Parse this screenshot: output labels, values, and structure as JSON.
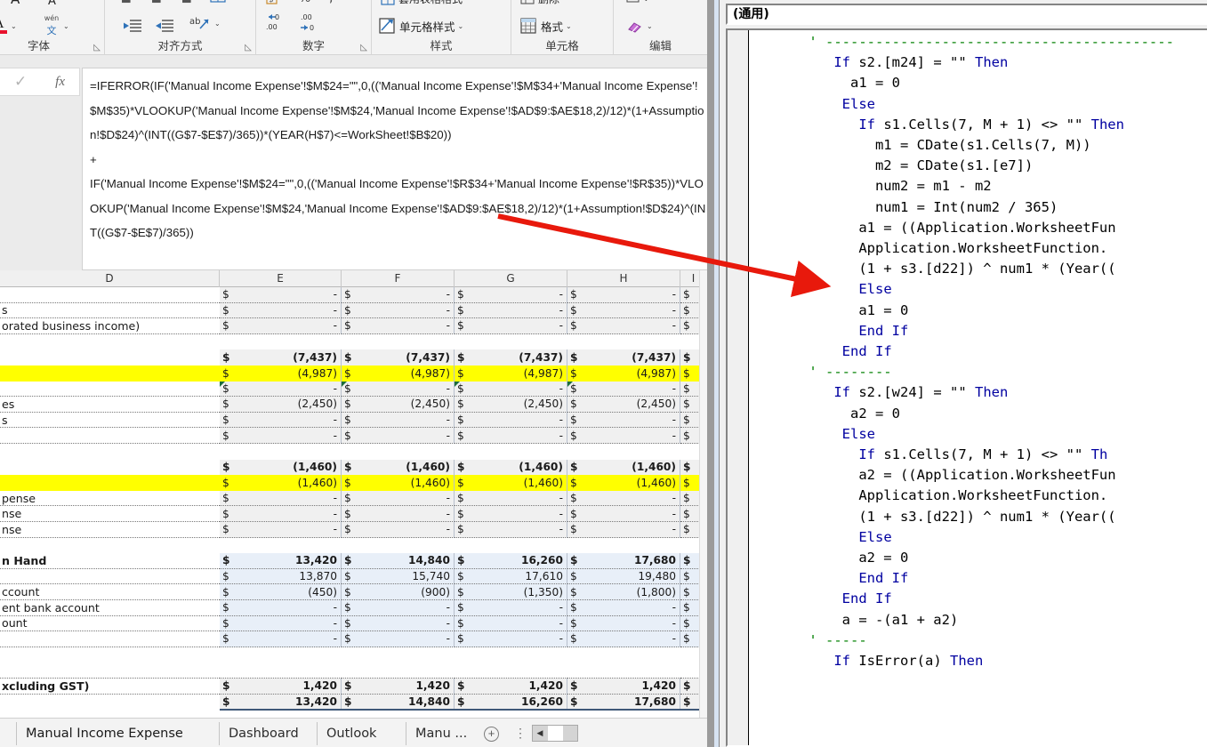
{
  "ribbon": {
    "groups": [
      {
        "title": "字体",
        "has_launcher": true
      },
      {
        "title": "对齐方式",
        "has_launcher": true
      },
      {
        "title": "数字",
        "has_launcher": true
      },
      {
        "title": "样式",
        "has_launcher": false
      },
      {
        "title": "单元格",
        "has_launcher": false
      },
      {
        "title": "编辑",
        "has_launcher": false
      }
    ],
    "buttons": {
      "font_color": "font-color-A",
      "phonetic_top": "wén",
      "phonetic_bottom": "文",
      "cell_styles": "单元格样式",
      "format": "格式",
      "clear": "clear-eraser"
    }
  },
  "formula_bar": {
    "cancel_icon": "check-icon",
    "fx_icon": "fx",
    "value": "=IFERROR(IF('Manual Income Expense'!$M$24=\"\",0,(('Manual Income Expense'!$M$34+'Manual Income Expense'!$M$35)*VLOOKUP('Manual Income Expense'!$M$24,'Manual Income Expense'!$AD$9:$AE$18,2)/12)*(1+Assumption!$D$24)^(INT((G$7-$E$7)/365))*(YEAR(H$7)<=WorkSheet!$B$20))\n+\nIF('Manual Income Expense'!$M$24=\"\",0,(('Manual Income Expense'!$R$34+'Manual Income Expense'!$R$35))*VLOOKUP('Manual Income Expense'!$M$24,'Manual Income Expense'!$AD$9:$AE$18,2)/12)*(1+Assumption!$D$24)^(INT((G$7-$E$7)/365))"
  },
  "grid": {
    "columns": [
      "D",
      "E",
      "F",
      "G",
      "H",
      "I"
    ],
    "rows": [
      {
        "label": "",
        "values": [
          "-",
          "-",
          "-",
          "-",
          "$"
        ],
        "style": "shade dot"
      },
      {
        "label": "s",
        "values": [
          "-",
          "-",
          "-",
          "-",
          "$"
        ],
        "style": "shade dot"
      },
      {
        "label": "orated business income)",
        "values": [
          "-",
          "-",
          "-",
          "-",
          "$"
        ],
        "style": "shade dot"
      },
      {
        "label": "",
        "values": [
          "",
          "",
          "",
          "",
          ""
        ],
        "style": "blank"
      },
      {
        "label": "",
        "values": [
          "(7,437)",
          "(7,437)",
          "(7,437)",
          "(7,437)",
          "$"
        ],
        "style": "shade bold"
      },
      {
        "label": "",
        "values": [
          "(4,987)",
          "(4,987)",
          "(4,987)",
          "(4,987)",
          "$"
        ],
        "style": "yellow"
      },
      {
        "label": "",
        "values": [
          "-",
          "-",
          "-",
          "-",
          "$"
        ],
        "style": "shade dot comment"
      },
      {
        "label": "es",
        "values": [
          "(2,450)",
          "(2,450)",
          "(2,450)",
          "(2,450)",
          "$"
        ],
        "style": "shade dot"
      },
      {
        "label": "s",
        "values": [
          "-",
          "-",
          "-",
          "-",
          "$"
        ],
        "style": "shade dot"
      },
      {
        "label": "",
        "values": [
          "-",
          "-",
          "-",
          "-",
          "$"
        ],
        "style": "shade dot"
      },
      {
        "label": "",
        "values": [
          "",
          "",
          "",
          "",
          ""
        ],
        "style": "blank"
      },
      {
        "label": "",
        "values": [
          "(1,460)",
          "(1,460)",
          "(1,460)",
          "(1,460)",
          "$"
        ],
        "style": "shade bold"
      },
      {
        "label": "",
        "values": [
          "(1,460)",
          "(1,460)",
          "(1,460)",
          "(1,460)",
          "$"
        ],
        "style": "yellow"
      },
      {
        "label": "pense",
        "values": [
          "-",
          "-",
          "-",
          "-",
          "$"
        ],
        "style": "shade dot"
      },
      {
        "label": "nse",
        "values": [
          "-",
          "-",
          "-",
          "-",
          "$"
        ],
        "style": "shade dot"
      },
      {
        "label": "nse",
        "values": [
          "-",
          "-",
          "-",
          "-",
          "$"
        ],
        "style": "shade dot"
      },
      {
        "label": "",
        "values": [
          "",
          "",
          "",
          "",
          ""
        ],
        "style": "blank"
      },
      {
        "label": "n Hand",
        "values": [
          "13,420",
          "14,840",
          "16,260",
          "17,680",
          "$"
        ],
        "style": "blue bold dot"
      },
      {
        "label": "",
        "values": [
          "13,870",
          "15,740",
          "17,610",
          "19,480",
          "$"
        ],
        "style": "blue dot"
      },
      {
        "label": "ccount",
        "values": [
          "(450)",
          "(900)",
          "(1,350)",
          "(1,800)",
          "$"
        ],
        "style": "blue dot"
      },
      {
        "label": "ent bank account",
        "values": [
          "-",
          "-",
          "-",
          "-",
          "$"
        ],
        "style": "blue dot"
      },
      {
        "label": "ount",
        "values": [
          "-",
          "-",
          "-",
          "-",
          "$"
        ],
        "style": "blue dot"
      },
      {
        "label": "",
        "values": [
          "-",
          "-",
          "-",
          "-",
          "$"
        ],
        "style": "blue dot"
      },
      {
        "label": "",
        "values": [
          "",
          "",
          "",
          "",
          ""
        ],
        "style": "blank"
      },
      {
        "label": "",
        "values": [
          "",
          "",
          "",
          "",
          ""
        ],
        "style": "blank dot"
      },
      {
        "label": "xcluding GST)",
        "values": [
          "1,420",
          "1,420",
          "1,420",
          "1,420",
          "$"
        ],
        "style": "shade bold dot"
      },
      {
        "label": "",
        "values": [
          "13,420",
          "14,840",
          "16,260",
          "17,680",
          "$"
        ],
        "style": "shade bold"
      }
    ],
    "currency_symbol": "$"
  },
  "sheet_tabs": {
    "items": [
      "Manual Income Expense",
      "Dashboard",
      "Outlook",
      "Manu ..."
    ],
    "add_label": "+",
    "more_label": "⋮",
    "scroll_arrow": "◀"
  },
  "vbe": {
    "combo_label": "(通用)",
    "code_lines": [
      {
        "indent": 0,
        "text": "",
        "cls": ""
      },
      {
        "indent": 7,
        "text": "' ------------------------------------------",
        "cls": "cm"
      },
      {
        "indent": 10,
        "text": "If s2.[m24] = \"\" Then",
        "cls": "kw-if"
      },
      {
        "indent": 12,
        "text": "a1 = 0",
        "cls": ""
      },
      {
        "indent": 11,
        "text": "Else",
        "cls": "kw"
      },
      {
        "indent": 13,
        "text": "If s1.Cells(7, M + 1) <> \"\" Then",
        "cls": "kw-if"
      },
      {
        "indent": 15,
        "text": "m1 = CDate(s1.Cells(7, M))",
        "cls": ""
      },
      {
        "indent": 15,
        "text": "m2 = CDate(s1.[e7])",
        "cls": ""
      },
      {
        "indent": 15,
        "text": "num2 = m1 - m2",
        "cls": ""
      },
      {
        "indent": 15,
        "text": "num1 = Int(num2 / 365)",
        "cls": ""
      },
      {
        "indent": 13,
        "text": "a1 = ((Application.WorksheetFun",
        "cls": ""
      },
      {
        "indent": 13,
        "text": "Application.WorksheetFunction.",
        "cls": ""
      },
      {
        "indent": 13,
        "text": "(1 + s3.[d22]) ^ num1 * (Year((",
        "cls": ""
      },
      {
        "indent": 13,
        "text": "Else",
        "cls": "kw"
      },
      {
        "indent": 13,
        "text": "a1 = 0",
        "cls": ""
      },
      {
        "indent": 13,
        "text": "End If",
        "cls": "kw"
      },
      {
        "indent": 0,
        "text": "",
        "cls": ""
      },
      {
        "indent": 11,
        "text": "End If",
        "cls": "kw"
      },
      {
        "indent": 7,
        "text": "' --------",
        "cls": "cm"
      },
      {
        "indent": 10,
        "text": "If s2.[w24] = \"\" Then",
        "cls": "kw-if"
      },
      {
        "indent": 12,
        "text": "a2 = 0",
        "cls": ""
      },
      {
        "indent": 11,
        "text": "Else",
        "cls": "kw"
      },
      {
        "indent": 13,
        "text": "If s1.Cells(7, M + 1) <> \"\" Th",
        "cls": "kw-if"
      },
      {
        "indent": 13,
        "text": "a2 = ((Application.WorksheetFun",
        "cls": ""
      },
      {
        "indent": 13,
        "text": "Application.WorksheetFunction.",
        "cls": ""
      },
      {
        "indent": 13,
        "text": "(1 + s3.[d22]) ^ num1 * (Year((",
        "cls": ""
      },
      {
        "indent": 0,
        "text": "",
        "cls": ""
      },
      {
        "indent": 13,
        "text": "Else",
        "cls": "kw"
      },
      {
        "indent": 13,
        "text": "a2 = 0",
        "cls": ""
      },
      {
        "indent": 13,
        "text": "End If",
        "cls": "kw"
      },
      {
        "indent": 11,
        "text": "End If",
        "cls": "kw"
      },
      {
        "indent": 0,
        "text": "",
        "cls": ""
      },
      {
        "indent": 11,
        "text": "a = -(a1 + a2)",
        "cls": ""
      },
      {
        "indent": 0,
        "text": "",
        "cls": ""
      },
      {
        "indent": 7,
        "text": "' -----",
        "cls": "cm"
      },
      {
        "indent": 10,
        "text": "If IsError(a) Then",
        "cls": "kw-if"
      }
    ]
  },
  "annotation": {
    "arrow_color": "#e8190c",
    "arrow_name": "red-annotation-arrow"
  },
  "colors": {
    "highlight_yellow": "#ffff00",
    "blue_row": "#e8eff8",
    "grey_row": "#f0f0f0",
    "vba_keyword": "#0000a0",
    "vba_comment": "#008000"
  }
}
